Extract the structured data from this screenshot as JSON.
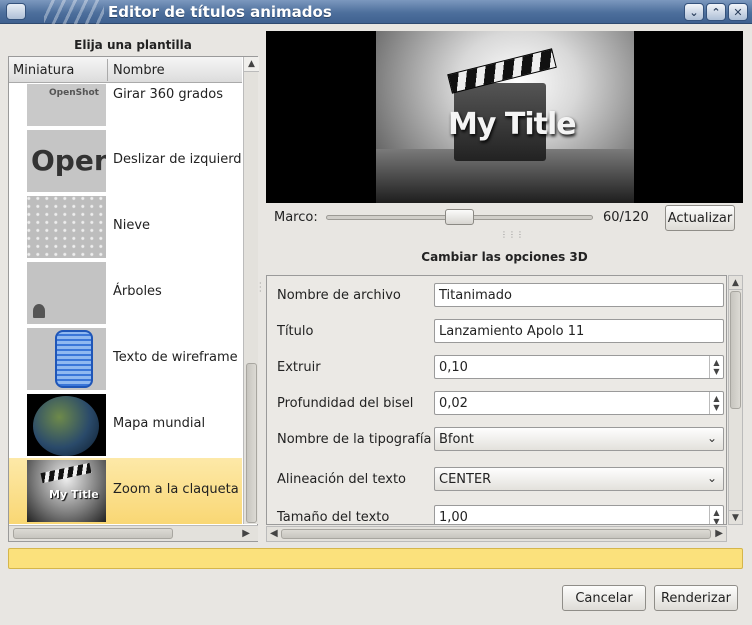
{
  "window": {
    "title": "Editor de títulos animados"
  },
  "templates": {
    "heading": "Elija una plantilla",
    "columns": [
      "Miniatura",
      "Nombre"
    ],
    "items": [
      {
        "name": "Girar 360 grados",
        "thumb_text": "OpenShot"
      },
      {
        "name": "Deslizar de izquierda",
        "thumb_text": "OpenS"
      },
      {
        "name": "Nieve"
      },
      {
        "name": "Árboles"
      },
      {
        "name": "Texto de wireframe"
      },
      {
        "name": "Mapa mundial"
      },
      {
        "name": "Zoom a la claqueta",
        "selected": true,
        "thumb_text": "My Title"
      }
    ]
  },
  "preview": {
    "title_text": "My Title"
  },
  "frame": {
    "label": "Marco:",
    "value": "60/120",
    "current": 60,
    "total": 120,
    "refresh_label": "Actualizar"
  },
  "options": {
    "heading": "Cambiar las opciones 3D",
    "fields": [
      {
        "label": "Nombre de archivo",
        "value": "Titanimado",
        "kind": "text"
      },
      {
        "label": "Título",
        "value": "Lanzamiento Apolo 11",
        "kind": "text"
      },
      {
        "label": "Extruir",
        "value": "0,10",
        "kind": "spin"
      },
      {
        "label": "Profundidad del bisel",
        "value": "0,02",
        "kind": "spin"
      },
      {
        "label": "Nombre de la tipografía",
        "value": "Bfont",
        "kind": "combo"
      },
      {
        "label": "Alineación del texto",
        "value": "CENTER",
        "kind": "combo"
      },
      {
        "label": "Tamaño del texto",
        "value": "1,00",
        "kind": "spin"
      }
    ]
  },
  "buttons": {
    "cancel": "Cancelar",
    "render": "Renderizar"
  },
  "colors": {
    "titlebar": "#4d6f9c",
    "selection": "#f9d774",
    "progress": "#fbe17c"
  }
}
